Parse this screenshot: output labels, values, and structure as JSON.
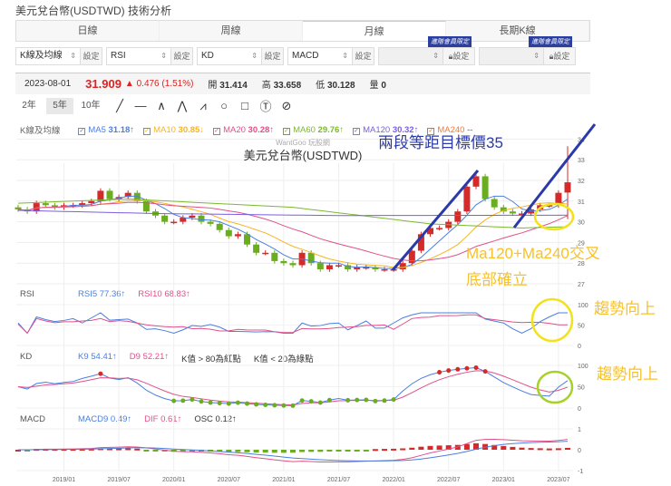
{
  "page_title": "美元兌台幣(USDTWD) 技術分析",
  "tabs": [
    {
      "label": "日線"
    },
    {
      "label": "周線"
    },
    {
      "label": "月線",
      "active": true
    },
    {
      "label": "長期K線"
    }
  ],
  "selects": [
    {
      "value": "K線及均線",
      "btn": "設定"
    },
    {
      "value": "RSI",
      "btn": "設定"
    },
    {
      "value": "KD",
      "btn": "設定"
    },
    {
      "value": "MACD",
      "btn": "設定"
    },
    {
      "value": "",
      "btn": "設定",
      "badge": "進階會員限定"
    },
    {
      "value": "",
      "btn": "設定",
      "badge": "進階會員限定"
    }
  ],
  "info": {
    "date": "2023-08-01",
    "price": "31.909",
    "change": "▲ 0.476 (1.51%)",
    "open_label": "開",
    "open": "31.414",
    "high_label": "高",
    "high": "33.658",
    "low_label": "低",
    "low": "30.128",
    "vol_label": "量",
    "vol": "0"
  },
  "range": [
    "2年",
    "5年",
    "10年"
  ],
  "tools": [
    "line-tool",
    "horizontal-line-tool",
    "angle-tool",
    "abc-pattern-tool",
    "abcd-pattern-tool",
    "circle-tool",
    "rectangle-tool",
    "text-tool",
    "hide-drawings-tool"
  ],
  "legend": {
    "label": "K線及均線",
    "items": [
      {
        "name": "MA5",
        "value": "31.18↑",
        "color": "#4a7fe0"
      },
      {
        "name": "MA10",
        "value": "30.85↓",
        "color": "#f5b521"
      },
      {
        "name": "MA20",
        "value": "30.28↑",
        "color": "#e0508a"
      },
      {
        "name": "MA60",
        "value": "29.76↑",
        "color": "#7cb82f"
      },
      {
        "name": "MA120",
        "value": "30.32↑",
        "color": "#7b5ee0"
      },
      {
        "name": "MA240",
        "value": "--",
        "color": "#f07b3c"
      }
    ]
  },
  "watermark": "WantGoo 玩股網",
  "chart_title": "美元兌台幣(USDTWD)",
  "annotations": {
    "target": "兩段等距目標價35",
    "cross": "Ma120+Ma240交叉",
    "bottom": "底部確立",
    "trend_rsi": "趨勢向上",
    "trend_kd": "趨勢向上"
  },
  "rsi": {
    "label": "RSI",
    "rsi5": "RSI5 77.36↑",
    "rsi10": "RSI10 68.83↑"
  },
  "kd": {
    "label": "KD",
    "k": "K9 54.41↑",
    "d": "D9 52.21↑",
    "note1": "K值 > 80為紅點",
    "note2": "K值 < 20為綠點"
  },
  "macd": {
    "label": "MACD",
    "macd9": "MACD9 0.49↑",
    "dif": "DIF 0.61↑",
    "osc": "OSC 0.12↑"
  },
  "colors": {
    "up": "#d42a2a",
    "down": "#6aad1f",
    "blue": "#2b3aa8",
    "yellow": "#f7c12b"
  },
  "chart_data": {
    "type": "candlestick",
    "start": "2018/08",
    "close": [
      30.6,
      30.5,
      30.9,
      30.8,
      30.7,
      30.8,
      30.8,
      30.9,
      31.0,
      31.5,
      31.1,
      31.2,
      31.4,
      31.0,
      30.5,
      30.3,
      30.0,
      30.0,
      30.2,
      30.3,
      30.0,
      29.9,
      29.6,
      29.3,
      29.4,
      28.9,
      28.5,
      28.5,
      28.1,
      28.0,
      27.9,
      28.5,
      28.0,
      27.7,
      27.9,
      27.9,
      27.7,
      27.8,
      27.8,
      27.7,
      27.7,
      27.7,
      28.0,
      28.6,
      29.4,
      29.7,
      29.7,
      30.0,
      30.5,
      31.7,
      32.2,
      31.1,
      30.7,
      30.5,
      30.4,
      30.4,
      30.6,
      30.8,
      30.8,
      31.4,
      31.9
    ],
    "last_ohlc": [
      31.414,
      33.658,
      30.128,
      31.909
    ],
    "ma60_keys": [
      [
        0,
        30.9
      ],
      [
        12,
        31.1
      ],
      [
        30,
        30.7
      ],
      [
        45,
        29.9
      ],
      [
        55,
        29.7
      ],
      [
        60,
        29.76
      ]
    ],
    "ma120_keys": [
      [
        0,
        30.55
      ],
      [
        15,
        30.4
      ],
      [
        35,
        30.3
      ],
      [
        60,
        30.32
      ]
    ],
    "x_ticks": [
      "2019/01",
      "2019/07",
      "2020/01",
      "2020/07",
      "2021/01",
      "2021/07",
      "2022/01",
      "2022/07",
      "2023/01",
      "2023/07"
    ],
    "y_ticks": [
      27,
      28,
      29,
      30,
      31,
      32,
      33,
      34
    ],
    "rsi_ticks": [
      0,
      50,
      100
    ],
    "kd_ticks": [
      0,
      50,
      100
    ],
    "macd_ticks": [
      -1,
      0,
      1
    ]
  }
}
